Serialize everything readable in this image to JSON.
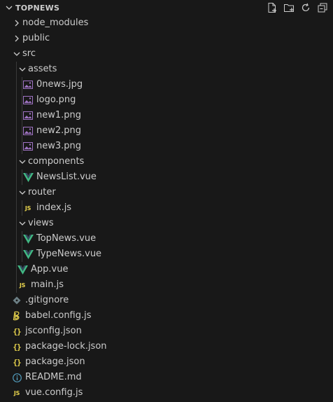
{
  "explorer": {
    "title": "TOPNEWS",
    "actions": [
      "new-file",
      "new-folder",
      "refresh",
      "collapse-all"
    ]
  },
  "tree": [
    {
      "label": "node_modules",
      "depth": 0,
      "type": "folder",
      "expanded": false,
      "icon": "chevron-right"
    },
    {
      "label": "public",
      "depth": 0,
      "type": "folder",
      "expanded": false,
      "icon": "chevron-right"
    },
    {
      "label": "src",
      "depth": 0,
      "type": "folder",
      "expanded": true,
      "icon": "chevron-down"
    },
    {
      "label": "assets",
      "depth": 1,
      "type": "folder",
      "expanded": true,
      "icon": "chevron-down"
    },
    {
      "label": "0news.jpg",
      "depth": 2,
      "type": "file",
      "icon": "image"
    },
    {
      "label": "logo.png",
      "depth": 2,
      "type": "file",
      "icon": "image"
    },
    {
      "label": "new1.png",
      "depth": 2,
      "type": "file",
      "icon": "image"
    },
    {
      "label": "new2.png",
      "depth": 2,
      "type": "file",
      "icon": "image"
    },
    {
      "label": "new3.png",
      "depth": 2,
      "type": "file",
      "icon": "image"
    },
    {
      "label": "components",
      "depth": 1,
      "type": "folder",
      "expanded": true,
      "icon": "chevron-down"
    },
    {
      "label": "NewsList.vue",
      "depth": 2,
      "type": "file",
      "icon": "vue"
    },
    {
      "label": "router",
      "depth": 1,
      "type": "folder",
      "expanded": true,
      "icon": "chevron-down"
    },
    {
      "label": "index.js",
      "depth": 2,
      "type": "file",
      "icon": "js"
    },
    {
      "label": "views",
      "depth": 1,
      "type": "folder",
      "expanded": true,
      "icon": "chevron-down"
    },
    {
      "label": "TopNews.vue",
      "depth": 2,
      "type": "file",
      "icon": "vue"
    },
    {
      "label": "TypeNews.vue",
      "depth": 2,
      "type": "file",
      "icon": "vue"
    },
    {
      "label": "App.vue",
      "depth": 1,
      "type": "file",
      "icon": "vue"
    },
    {
      "label": "main.js",
      "depth": 1,
      "type": "file",
      "icon": "js"
    },
    {
      "label": ".gitignore",
      "depth": 0,
      "type": "file",
      "icon": "git"
    },
    {
      "label": "babel.config.js",
      "depth": 0,
      "type": "file",
      "icon": "babel"
    },
    {
      "label": "jsconfig.json",
      "depth": 0,
      "type": "file",
      "icon": "json"
    },
    {
      "label": "package-lock.json",
      "depth": 0,
      "type": "file",
      "icon": "json"
    },
    {
      "label": "package.json",
      "depth": 0,
      "type": "file",
      "icon": "json"
    },
    {
      "label": "README.md",
      "depth": 0,
      "type": "file",
      "icon": "info"
    },
    {
      "label": "vue.config.js",
      "depth": 0,
      "type": "file",
      "icon": "js"
    }
  ],
  "colors": {
    "background": "#181818",
    "text": "#cccccc",
    "js": "#e8d44d",
    "json": "#e8d44d",
    "vue": "#41b883",
    "image": "#a074c4",
    "git": "#6d8086",
    "info": "#519aba",
    "babel": "#e8d44d"
  }
}
